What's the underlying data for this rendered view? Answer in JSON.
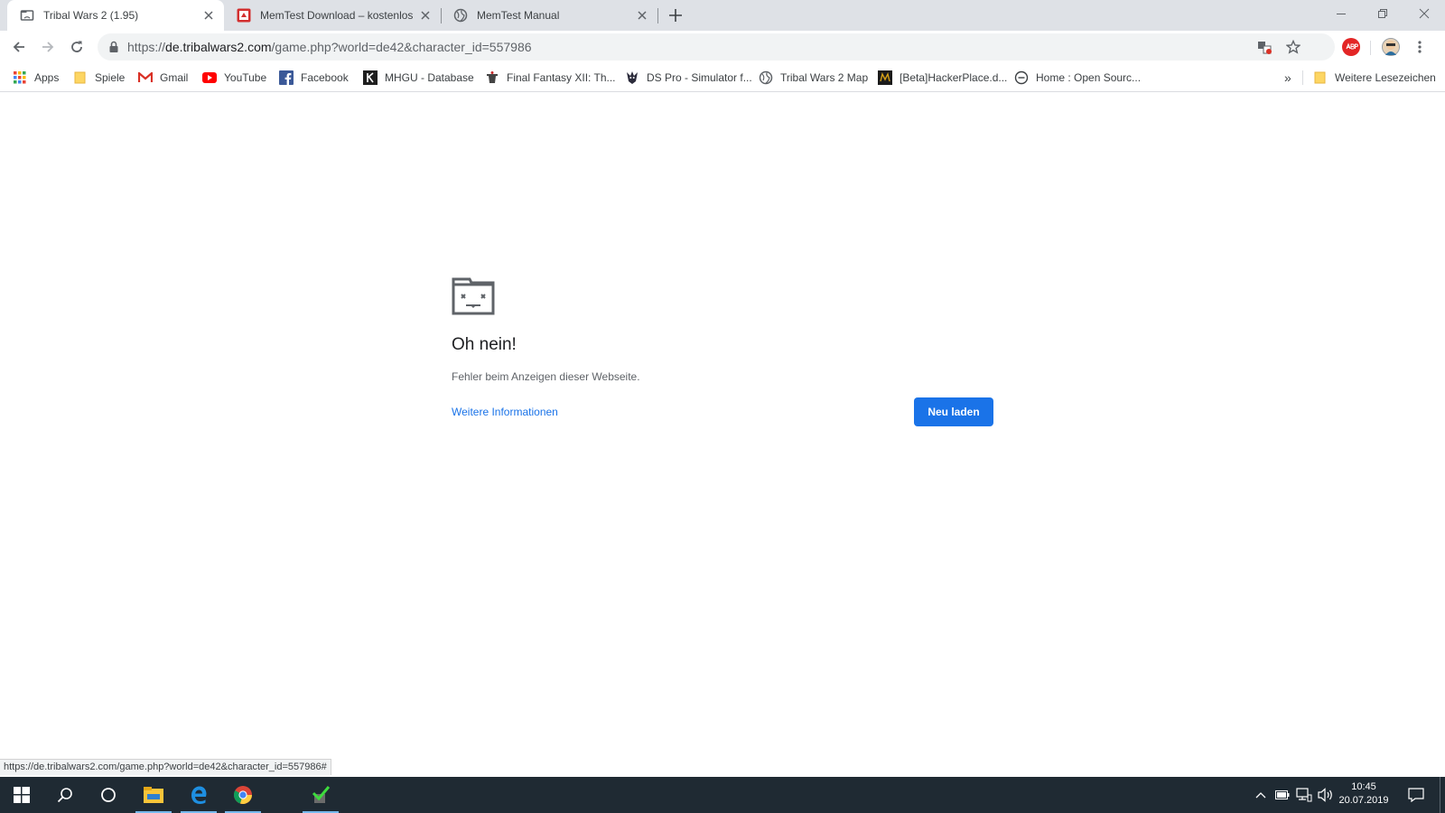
{
  "tabs": [
    {
      "title": "Tribal Wars 2 (1.95)",
      "icon": "sad-tab-icon",
      "active": true
    },
    {
      "title": "MemTest Download – kostenlos –",
      "icon": "memtest-favicon",
      "active": false
    },
    {
      "title": "MemTest Manual",
      "icon": "globe-icon",
      "active": false
    }
  ],
  "address_bar": {
    "url_scheme": "https://",
    "url_host": "de.tribalwars2.com",
    "url_path": "/game.php?world=de42&character_id=557986"
  },
  "bookmarks": [
    {
      "label": "Apps",
      "icon": "apps-grid-icon"
    },
    {
      "label": "Spiele",
      "icon": "folder-icon"
    },
    {
      "label": "Gmail",
      "icon": "gmail-icon"
    },
    {
      "label": "YouTube",
      "icon": "youtube-icon"
    },
    {
      "label": "Facebook",
      "icon": "facebook-icon"
    },
    {
      "label": "MHGU - Database",
      "icon": "kiranico-icon"
    },
    {
      "label": "Final Fantasy XII: Th...",
      "icon": "moogle-icon"
    },
    {
      "label": "DS Pro - Simulator f...",
      "icon": "dspro-icon"
    },
    {
      "label": "Tribal Wars 2 Map",
      "icon": "globe-icon"
    },
    {
      "label": "[Beta]HackerPlace.d...",
      "icon": "hackerplace-icon"
    },
    {
      "label": "Home : Open Sourc...",
      "icon": "opensource-icon"
    }
  ],
  "bookmarks_overflow": "»",
  "other_bookmarks": "Weitere Lesezeichen",
  "error_page": {
    "title": "Oh nein!",
    "message": "Fehler beim Anzeigen dieser Webseite.",
    "link": "Weitere Informationen",
    "button": "Neu laden"
  },
  "status_bar": "https://de.tribalwars2.com/game.php?world=de42&character_id=557986#",
  "taskbar": {
    "time": "10:45",
    "date": "20.07.2019"
  },
  "colors": {
    "accent": "#1a73e8",
    "tabstrip": "#dee1e6",
    "taskbar": "#1f2a33"
  }
}
